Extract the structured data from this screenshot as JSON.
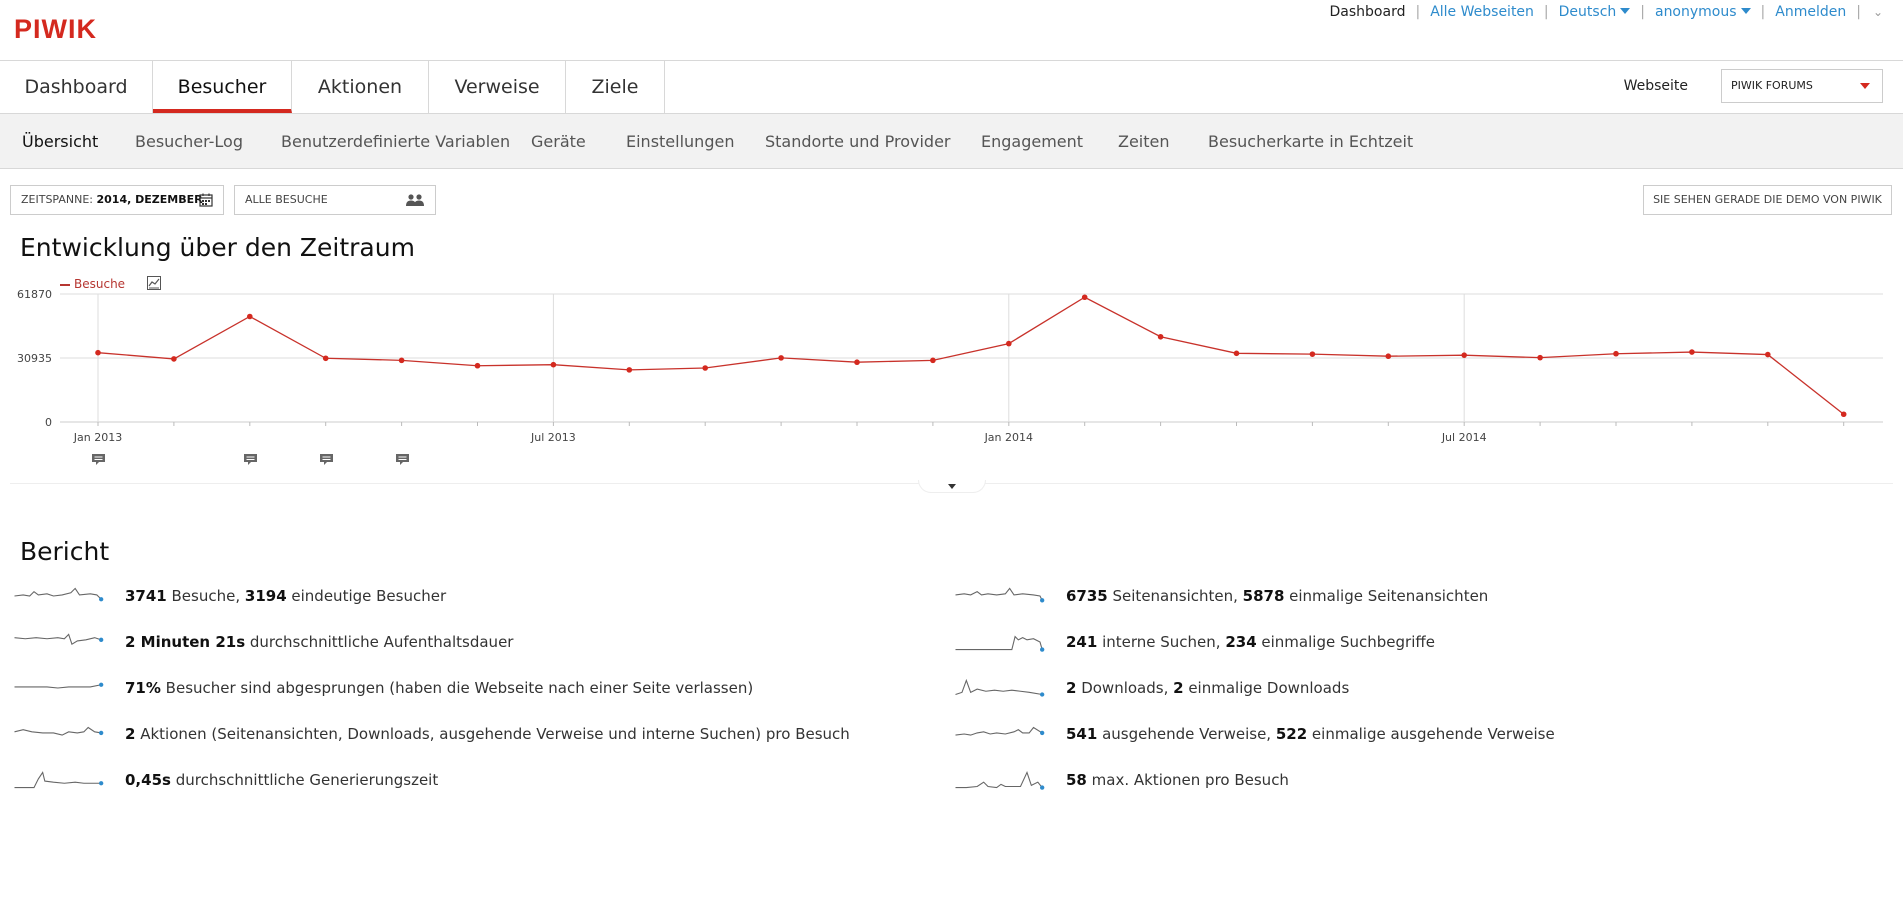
{
  "app": {
    "logo": "PIWIK"
  },
  "topnav": {
    "dashboard": "Dashboard",
    "all_websites": "Alle Webseiten",
    "language": "Deutsch",
    "user": "anonymous",
    "login": "Anmelden",
    "separator": "|"
  },
  "main_tabs": [
    "Dashboard",
    "Besucher",
    "Aktionen",
    "Verweise",
    "Ziele"
  ],
  "site": {
    "label": "Webseite",
    "selected": "PIWIK FORUMS"
  },
  "sub_tabs": [
    "Übersicht",
    "Besucher-Log",
    "Benutzerdefinierte Variablen",
    "Geräte",
    "Einstellungen",
    "Standorte und Provider",
    "Engagement",
    "Zeiten",
    "Besucherkarte in Echtzeit"
  ],
  "controls": {
    "period_label": "ZEITSPANNE:",
    "period_value": "2014, DEZEMBER",
    "segment": "ALLE BESUCHE",
    "demo": "SIE SEHEN GERADE DIE DEMO VON PIWIK"
  },
  "evolution": {
    "title": "Entwicklung über den Zeitraum",
    "legend": "Besuche"
  },
  "chart_data": {
    "type": "line",
    "series": [
      {
        "name": "Besuche",
        "color": "#d4291f",
        "values": [
          33500,
          30500,
          51000,
          30800,
          29800,
          27200,
          27700,
          25200,
          26100,
          31000,
          28900,
          29800,
          37900,
          60300,
          41200,
          33200,
          32800,
          31800,
          32300,
          31100,
          33000,
          33800,
          32600,
          3741
        ]
      }
    ],
    "x": [
      "2013-01",
      "2013-02",
      "2013-03",
      "2013-04",
      "2013-05",
      "2013-06",
      "2013-07",
      "2013-08",
      "2013-09",
      "2013-10",
      "2013-11",
      "2013-12",
      "2014-01",
      "2014-02",
      "2014-03",
      "2014-04",
      "2014-05",
      "2014-06",
      "2014-07",
      "2014-08",
      "2014-09",
      "2014-10",
      "2014-11",
      "2014-12"
    ],
    "x_tick_labels": [
      "Jan 2013",
      "Jul 2013",
      "Jan 2014",
      "Jul 2014"
    ],
    "y_tick_labels": [
      "61870",
      "30935",
      "0"
    ],
    "ylim": [
      0,
      61870
    ],
    "annotation_months": [
      "2013-01",
      "2013-03",
      "2013-04",
      "2013-05"
    ]
  },
  "report": {
    "title": "Bericht",
    "left": [
      {
        "parts": [
          [
            "3741",
            true
          ],
          [
            " Besuche, ",
            false
          ],
          [
            "3194",
            true
          ],
          [
            " eindeutige Besucher",
            false
          ]
        ]
      },
      {
        "parts": [
          [
            "2 Minuten 21s",
            true
          ],
          [
            " durchschnittliche Aufenthaltsdauer",
            false
          ]
        ]
      },
      {
        "parts": [
          [
            "71%",
            true
          ],
          [
            " Besucher sind abgesprungen (haben die Webseite nach einer Seite verlassen)",
            false
          ]
        ]
      },
      {
        "parts": [
          [
            "2",
            true
          ],
          [
            " Aktionen (Seitenansichten, Downloads, ausgehende Verweise und interne Suchen) pro Besuch",
            false
          ]
        ]
      },
      {
        "parts": [
          [
            "0,45s",
            true
          ],
          [
            " durchschnittliche Generierungszeit",
            false
          ]
        ]
      }
    ],
    "right": [
      {
        "parts": [
          [
            "6735",
            true
          ],
          [
            " Seitenansichten, ",
            false
          ],
          [
            "5878",
            true
          ],
          [
            " einmalige Seitenansichten",
            false
          ]
        ]
      },
      {
        "parts": [
          [
            "241",
            true
          ],
          [
            " interne Suchen, ",
            false
          ],
          [
            "234",
            true
          ],
          [
            " einmalige Suchbegriffe",
            false
          ]
        ]
      },
      {
        "parts": [
          [
            "2",
            true
          ],
          [
            " Downloads, ",
            false
          ],
          [
            "2",
            true
          ],
          [
            " einmalige Downloads",
            false
          ]
        ]
      },
      {
        "parts": [
          [
            "541",
            true
          ],
          [
            " ausgehende Verweise, ",
            false
          ],
          [
            "522",
            true
          ],
          [
            " einmalige ausgehende Verweise",
            false
          ]
        ]
      },
      {
        "parts": [
          [
            "58",
            true
          ],
          [
            " max. Aktionen pro Besuch",
            false
          ]
        ]
      }
    ]
  }
}
